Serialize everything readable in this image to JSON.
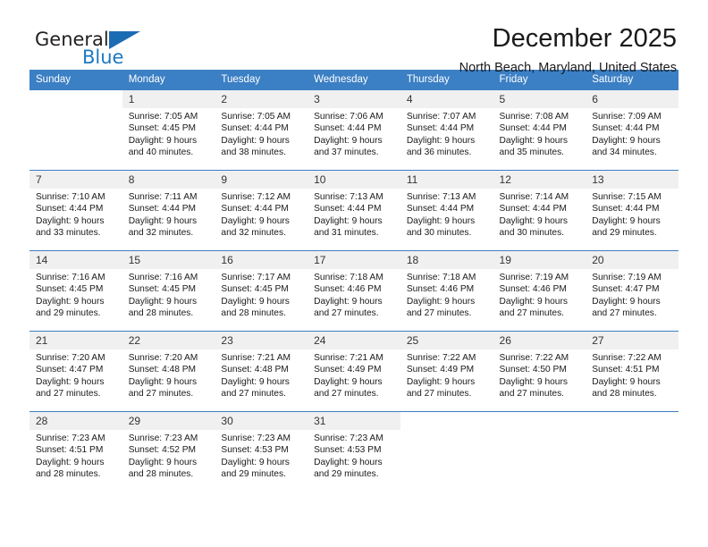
{
  "brand": {
    "name_part1": "General",
    "name_part2": "Blue",
    "logo_icon": "triangle-logo-icon"
  },
  "header": {
    "month_title": "December 2025",
    "location": "North Beach, Maryland, United States"
  },
  "colors": {
    "header_blue": "#3b7fc4",
    "brand_blue": "#1c79c0",
    "daynum_background": "#f0f0f0",
    "text": "#1a1a1a"
  },
  "weekdays": [
    "Sunday",
    "Monday",
    "Tuesday",
    "Wednesday",
    "Thursday",
    "Friday",
    "Saturday"
  ],
  "weeks": [
    [
      {
        "day": "",
        "sunrise": "",
        "sunset": "",
        "daylight1": "",
        "daylight2": ""
      },
      {
        "day": "1",
        "sunrise": "Sunrise: 7:05 AM",
        "sunset": "Sunset: 4:45 PM",
        "daylight1": "Daylight: 9 hours",
        "daylight2": "and 40 minutes."
      },
      {
        "day": "2",
        "sunrise": "Sunrise: 7:05 AM",
        "sunset": "Sunset: 4:44 PM",
        "daylight1": "Daylight: 9 hours",
        "daylight2": "and 38 minutes."
      },
      {
        "day": "3",
        "sunrise": "Sunrise: 7:06 AM",
        "sunset": "Sunset: 4:44 PM",
        "daylight1": "Daylight: 9 hours",
        "daylight2": "and 37 minutes."
      },
      {
        "day": "4",
        "sunrise": "Sunrise: 7:07 AM",
        "sunset": "Sunset: 4:44 PM",
        "daylight1": "Daylight: 9 hours",
        "daylight2": "and 36 minutes."
      },
      {
        "day": "5",
        "sunrise": "Sunrise: 7:08 AM",
        "sunset": "Sunset: 4:44 PM",
        "daylight1": "Daylight: 9 hours",
        "daylight2": "and 35 minutes."
      },
      {
        "day": "6",
        "sunrise": "Sunrise: 7:09 AM",
        "sunset": "Sunset: 4:44 PM",
        "daylight1": "Daylight: 9 hours",
        "daylight2": "and 34 minutes."
      }
    ],
    [
      {
        "day": "7",
        "sunrise": "Sunrise: 7:10 AM",
        "sunset": "Sunset: 4:44 PM",
        "daylight1": "Daylight: 9 hours",
        "daylight2": "and 33 minutes."
      },
      {
        "day": "8",
        "sunrise": "Sunrise: 7:11 AM",
        "sunset": "Sunset: 4:44 PM",
        "daylight1": "Daylight: 9 hours",
        "daylight2": "and 32 minutes."
      },
      {
        "day": "9",
        "sunrise": "Sunrise: 7:12 AM",
        "sunset": "Sunset: 4:44 PM",
        "daylight1": "Daylight: 9 hours",
        "daylight2": "and 32 minutes."
      },
      {
        "day": "10",
        "sunrise": "Sunrise: 7:13 AM",
        "sunset": "Sunset: 4:44 PM",
        "daylight1": "Daylight: 9 hours",
        "daylight2": "and 31 minutes."
      },
      {
        "day": "11",
        "sunrise": "Sunrise: 7:13 AM",
        "sunset": "Sunset: 4:44 PM",
        "daylight1": "Daylight: 9 hours",
        "daylight2": "and 30 minutes."
      },
      {
        "day": "12",
        "sunrise": "Sunrise: 7:14 AM",
        "sunset": "Sunset: 4:44 PM",
        "daylight1": "Daylight: 9 hours",
        "daylight2": "and 30 minutes."
      },
      {
        "day": "13",
        "sunrise": "Sunrise: 7:15 AM",
        "sunset": "Sunset: 4:44 PM",
        "daylight1": "Daylight: 9 hours",
        "daylight2": "and 29 minutes."
      }
    ],
    [
      {
        "day": "14",
        "sunrise": "Sunrise: 7:16 AM",
        "sunset": "Sunset: 4:45 PM",
        "daylight1": "Daylight: 9 hours",
        "daylight2": "and 29 minutes."
      },
      {
        "day": "15",
        "sunrise": "Sunrise: 7:16 AM",
        "sunset": "Sunset: 4:45 PM",
        "daylight1": "Daylight: 9 hours",
        "daylight2": "and 28 minutes."
      },
      {
        "day": "16",
        "sunrise": "Sunrise: 7:17 AM",
        "sunset": "Sunset: 4:45 PM",
        "daylight1": "Daylight: 9 hours",
        "daylight2": "and 28 minutes."
      },
      {
        "day": "17",
        "sunrise": "Sunrise: 7:18 AM",
        "sunset": "Sunset: 4:46 PM",
        "daylight1": "Daylight: 9 hours",
        "daylight2": "and 27 minutes."
      },
      {
        "day": "18",
        "sunrise": "Sunrise: 7:18 AM",
        "sunset": "Sunset: 4:46 PM",
        "daylight1": "Daylight: 9 hours",
        "daylight2": "and 27 minutes."
      },
      {
        "day": "19",
        "sunrise": "Sunrise: 7:19 AM",
        "sunset": "Sunset: 4:46 PM",
        "daylight1": "Daylight: 9 hours",
        "daylight2": "and 27 minutes."
      },
      {
        "day": "20",
        "sunrise": "Sunrise: 7:19 AM",
        "sunset": "Sunset: 4:47 PM",
        "daylight1": "Daylight: 9 hours",
        "daylight2": "and 27 minutes."
      }
    ],
    [
      {
        "day": "21",
        "sunrise": "Sunrise: 7:20 AM",
        "sunset": "Sunset: 4:47 PM",
        "daylight1": "Daylight: 9 hours",
        "daylight2": "and 27 minutes."
      },
      {
        "day": "22",
        "sunrise": "Sunrise: 7:20 AM",
        "sunset": "Sunset: 4:48 PM",
        "daylight1": "Daylight: 9 hours",
        "daylight2": "and 27 minutes."
      },
      {
        "day": "23",
        "sunrise": "Sunrise: 7:21 AM",
        "sunset": "Sunset: 4:48 PM",
        "daylight1": "Daylight: 9 hours",
        "daylight2": "and 27 minutes."
      },
      {
        "day": "24",
        "sunrise": "Sunrise: 7:21 AM",
        "sunset": "Sunset: 4:49 PM",
        "daylight1": "Daylight: 9 hours",
        "daylight2": "and 27 minutes."
      },
      {
        "day": "25",
        "sunrise": "Sunrise: 7:22 AM",
        "sunset": "Sunset: 4:49 PM",
        "daylight1": "Daylight: 9 hours",
        "daylight2": "and 27 minutes."
      },
      {
        "day": "26",
        "sunrise": "Sunrise: 7:22 AM",
        "sunset": "Sunset: 4:50 PM",
        "daylight1": "Daylight: 9 hours",
        "daylight2": "and 27 minutes."
      },
      {
        "day": "27",
        "sunrise": "Sunrise: 7:22 AM",
        "sunset": "Sunset: 4:51 PM",
        "daylight1": "Daylight: 9 hours",
        "daylight2": "and 28 minutes."
      }
    ],
    [
      {
        "day": "28",
        "sunrise": "Sunrise: 7:23 AM",
        "sunset": "Sunset: 4:51 PM",
        "daylight1": "Daylight: 9 hours",
        "daylight2": "and 28 minutes."
      },
      {
        "day": "29",
        "sunrise": "Sunrise: 7:23 AM",
        "sunset": "Sunset: 4:52 PM",
        "daylight1": "Daylight: 9 hours",
        "daylight2": "and 28 minutes."
      },
      {
        "day": "30",
        "sunrise": "Sunrise: 7:23 AM",
        "sunset": "Sunset: 4:53 PM",
        "daylight1": "Daylight: 9 hours",
        "daylight2": "and 29 minutes."
      },
      {
        "day": "31",
        "sunrise": "Sunrise: 7:23 AM",
        "sunset": "Sunset: 4:53 PM",
        "daylight1": "Daylight: 9 hours",
        "daylight2": "and 29 minutes."
      },
      {
        "day": "",
        "sunrise": "",
        "sunset": "",
        "daylight1": "",
        "daylight2": ""
      },
      {
        "day": "",
        "sunrise": "",
        "sunset": "",
        "daylight1": "",
        "daylight2": ""
      },
      {
        "day": "",
        "sunrise": "",
        "sunset": "",
        "daylight1": "",
        "daylight2": ""
      }
    ]
  ]
}
